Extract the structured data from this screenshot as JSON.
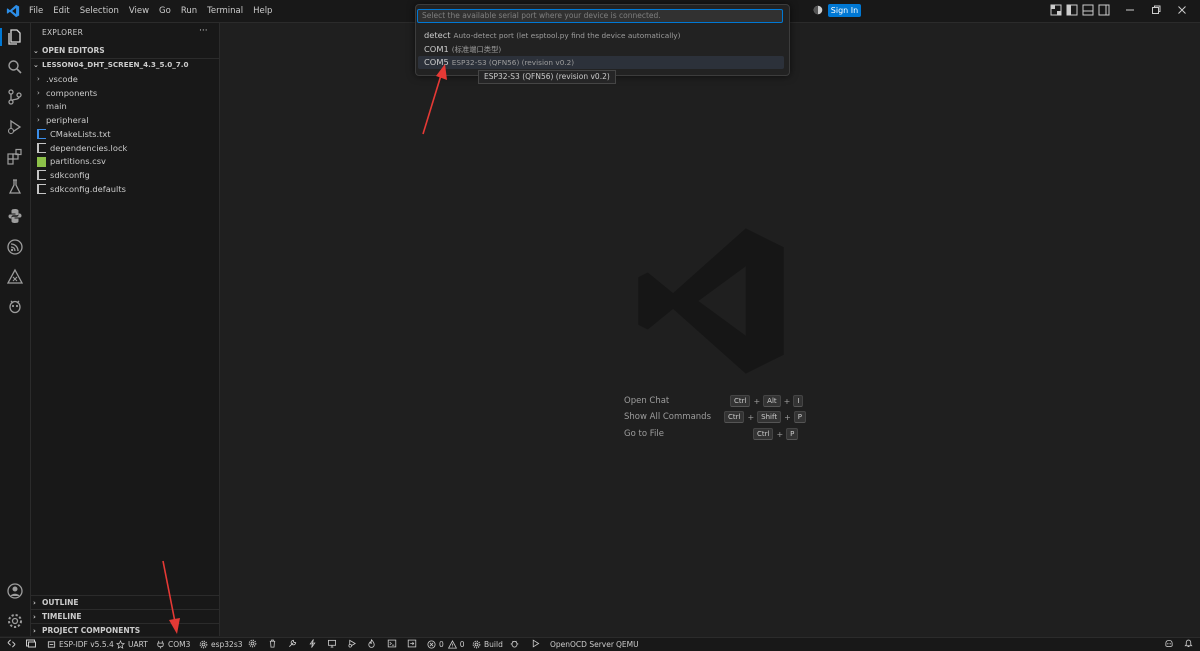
{
  "menu": [
    "File",
    "Edit",
    "Selection",
    "View",
    "Go",
    "Run",
    "Terminal",
    "Help"
  ],
  "titlebar": {
    "sign_in": "Sign In"
  },
  "explorer": {
    "title": "EXPLORER",
    "more": "···",
    "open_editors": "OPEN EDITORS",
    "project": "LESSON04_DHT_SCREEN_4.3_5.0_7.0",
    "items": [
      {
        "label": ".vscode",
        "kind": "folder"
      },
      {
        "label": "components",
        "kind": "folder"
      },
      {
        "label": "main",
        "kind": "folder"
      },
      {
        "label": "peripheral",
        "kind": "folder"
      },
      {
        "label": "CMakeLists.txt",
        "kind": "file",
        "color": "#3b8eea"
      },
      {
        "label": "dependencies.lock",
        "kind": "file",
        "color": "#c5c5c5"
      },
      {
        "label": "partitions.csv",
        "kind": "file",
        "color": "#8dc149"
      },
      {
        "label": "sdkconfig",
        "kind": "file",
        "color": "#c5c5c5"
      },
      {
        "label": "sdkconfig.defaults",
        "kind": "file",
        "color": "#c5c5c5"
      }
    ],
    "bottom_sections": [
      "OUTLINE",
      "TIMELINE",
      "PROJECT COMPONENTS"
    ]
  },
  "quickpick": {
    "placeholder": "Select the available serial port where your device is connected.",
    "items": [
      {
        "label": "detect",
        "description": "Auto-detect port (let esptool.py find the device automatically)"
      },
      {
        "label": "COM1",
        "description": "(标准端口类型)"
      },
      {
        "label": "COM5",
        "description": "ESP32-S3 (QFN56) (revision v0.2)"
      }
    ],
    "tooltip": "ESP32-S3 (QFN56) (revision v0.2)"
  },
  "shortcuts": [
    {
      "label": "Open Chat",
      "keys": [
        "Ctrl",
        "Alt",
        "I"
      ]
    },
    {
      "label": "Show All Commands",
      "keys": [
        "Ctrl",
        "Shift",
        "P"
      ]
    },
    {
      "label": "Go to File",
      "keys": [
        "Ctrl",
        "P"
      ]
    }
  ],
  "statusbar": {
    "idf": "ESP-IDF v5.5.4",
    "uart": "UART",
    "port": "COM3",
    "target": "esp32s3",
    "problems_errors": "0",
    "problems_warnings": "0",
    "build": "Build",
    "openocd": "OpenOCD Server",
    "qemu": "QEMU"
  },
  "colors": {
    "accent": "#0078d4",
    "background": "#1f1f1f",
    "arrow": "#e53935"
  }
}
